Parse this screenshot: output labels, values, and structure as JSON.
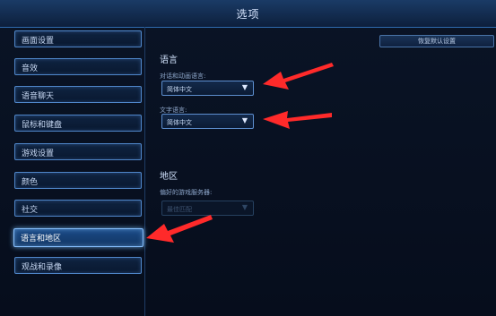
{
  "window": {
    "title": "选项"
  },
  "sidebar": {
    "items": [
      {
        "label": "画面设置"
      },
      {
        "label": "音效"
      },
      {
        "label": "语音聊天"
      },
      {
        "label": "鼠标和键盘"
      },
      {
        "label": "游戏设置"
      },
      {
        "label": "颜色"
      },
      {
        "label": "社交"
      },
      {
        "label": "语言和地区",
        "active": true
      },
      {
        "label": "观战和录像"
      }
    ]
  },
  "main": {
    "reset_button": "恢复默认设置",
    "language_section": {
      "title": "语言",
      "dialog_label": "对话和动画语言:",
      "dialog_value": "简体中文",
      "text_label": "文字语言:",
      "text_value": "简体中文"
    },
    "region_section": {
      "title": "地区",
      "server_label": "偏好的游戏服务器:",
      "server_value": "最佳匹配"
    }
  },
  "annotations": {
    "arrow_color": "#ff2a2a"
  },
  "colors": {
    "accent": "#5d8fcf",
    "active_glow": "#88c0ff",
    "background": "#060d1c"
  }
}
